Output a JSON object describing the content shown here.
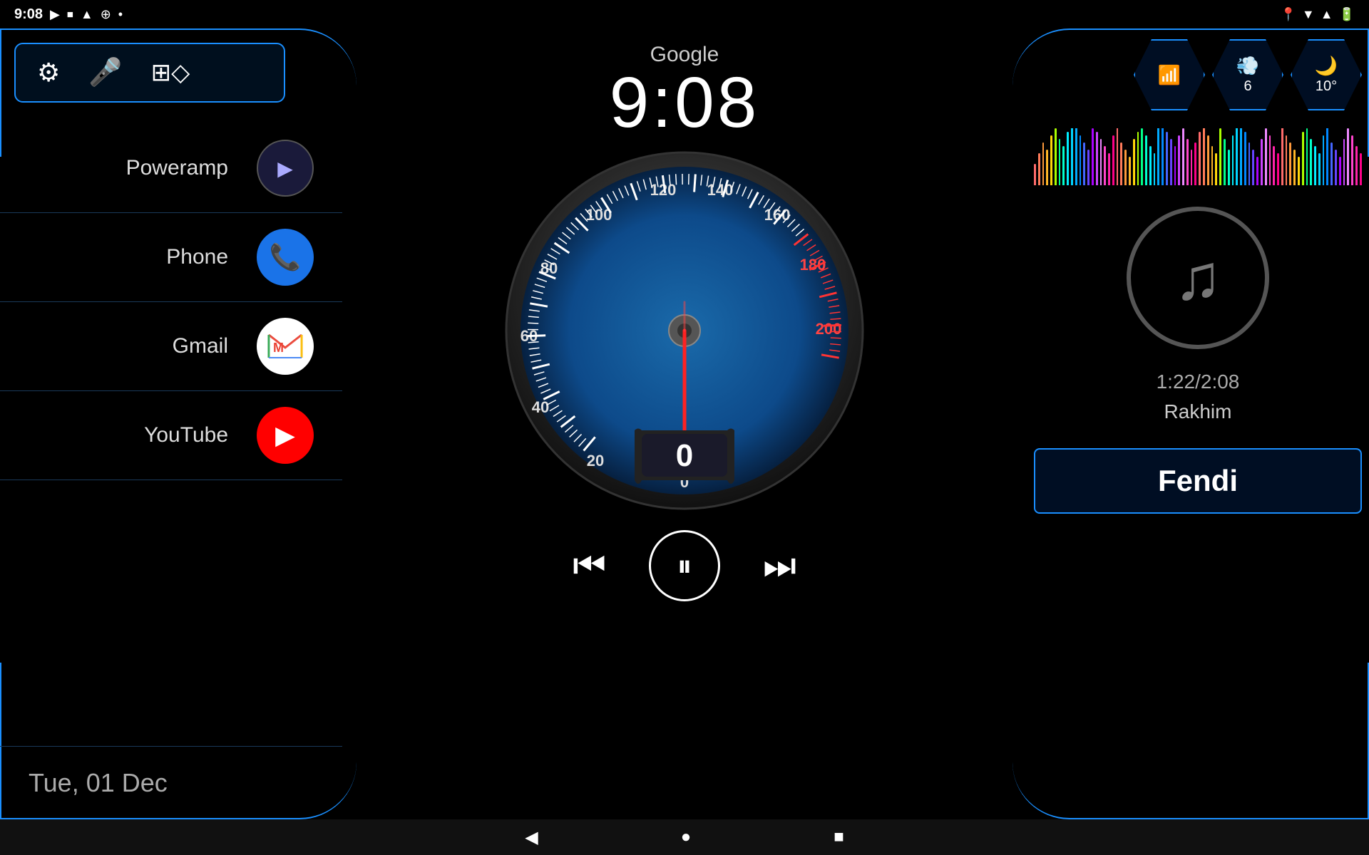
{
  "statusBar": {
    "time": "9:08",
    "leftIcons": [
      "▶",
      "⏹",
      "▲",
      "⊕",
      "•"
    ],
    "rightIcons": [
      "📍",
      "▼",
      "▲",
      "🔋"
    ]
  },
  "header": {
    "provider": "Google",
    "time": "9:08"
  },
  "controls": {
    "settingsIcon": "⚙",
    "micIcon": "🎤",
    "gridIcon": "⊞"
  },
  "apps": [
    {
      "name": "Poweramp",
      "iconBg": "#1a1a4a",
      "iconColor": "#fff",
      "iconSymbol": "▶",
      "type": "poweramp"
    },
    {
      "name": "Phone",
      "iconBg": "#1a73e8",
      "iconColor": "#fff",
      "iconSymbol": "📞",
      "type": "phone"
    },
    {
      "name": "Gmail",
      "iconBg": "#fff",
      "iconColor": "#ea4335",
      "iconSymbol": "M",
      "type": "gmail"
    },
    {
      "name": "YouTube",
      "iconBg": "#ff0000",
      "iconColor": "#fff",
      "iconSymbol": "▶",
      "type": "youtube"
    }
  ],
  "date": "Tue, 01 Dec",
  "speedometer": {
    "value": 0,
    "maxSpeed": 200,
    "markers": [
      0,
      20,
      40,
      60,
      80,
      100,
      120,
      140,
      160,
      180,
      200
    ]
  },
  "playback": {
    "prevLabel": "⏮",
    "pauseLabel": "⏸",
    "nextLabel": "⏭"
  },
  "rightPanel": {
    "wifi": {
      "symbol": "📶",
      "value": ""
    },
    "wind": {
      "symbol": "💨",
      "value": "6"
    },
    "weather": {
      "symbol": "🌙",
      "value": "10°"
    }
  },
  "music": {
    "time": "1:22/2:08",
    "artist": "Rakhim",
    "title": "Fendi"
  },
  "nav": {
    "back": "◀",
    "home": "●",
    "recent": "■"
  },
  "vizColors": [
    "#ff6b6b",
    "#ff7b5a",
    "#ff9a3c",
    "#ffb627",
    "#ffd60a",
    "#aaff00",
    "#00ff88",
    "#00ffcc",
    "#00eeff",
    "#00d4ff",
    "#00aaff",
    "#0088ff",
    "#4466ff",
    "#6644ff",
    "#aa00ff",
    "#cc44ff",
    "#ee88ff",
    "#ff44cc",
    "#ff22aa",
    "#ff0088"
  ],
  "vizHeights": [
    30,
    45,
    60,
    50,
    70,
    80,
    65,
    55,
    75,
    85,
    90,
    70,
    60,
    50,
    80,
    75,
    65,
    55,
    45,
    70,
    85,
    60,
    50,
    40,
    65,
    75,
    80,
    70,
    55,
    45,
    85,
    90,
    75,
    65,
    55,
    70,
    80,
    65,
    50,
    60,
    75,
    85,
    70,
    55,
    45,
    80,
    65,
    50,
    70,
    85,
    90,
    75,
    60,
    50,
    40,
    65,
    80,
    70,
    55,
    45,
    85,
    70,
    60,
    50,
    40,
    75,
    80,
    65,
    55,
    45,
    70,
    85,
    60,
    50,
    40,
    65,
    80,
    70,
    55,
    45
  ]
}
